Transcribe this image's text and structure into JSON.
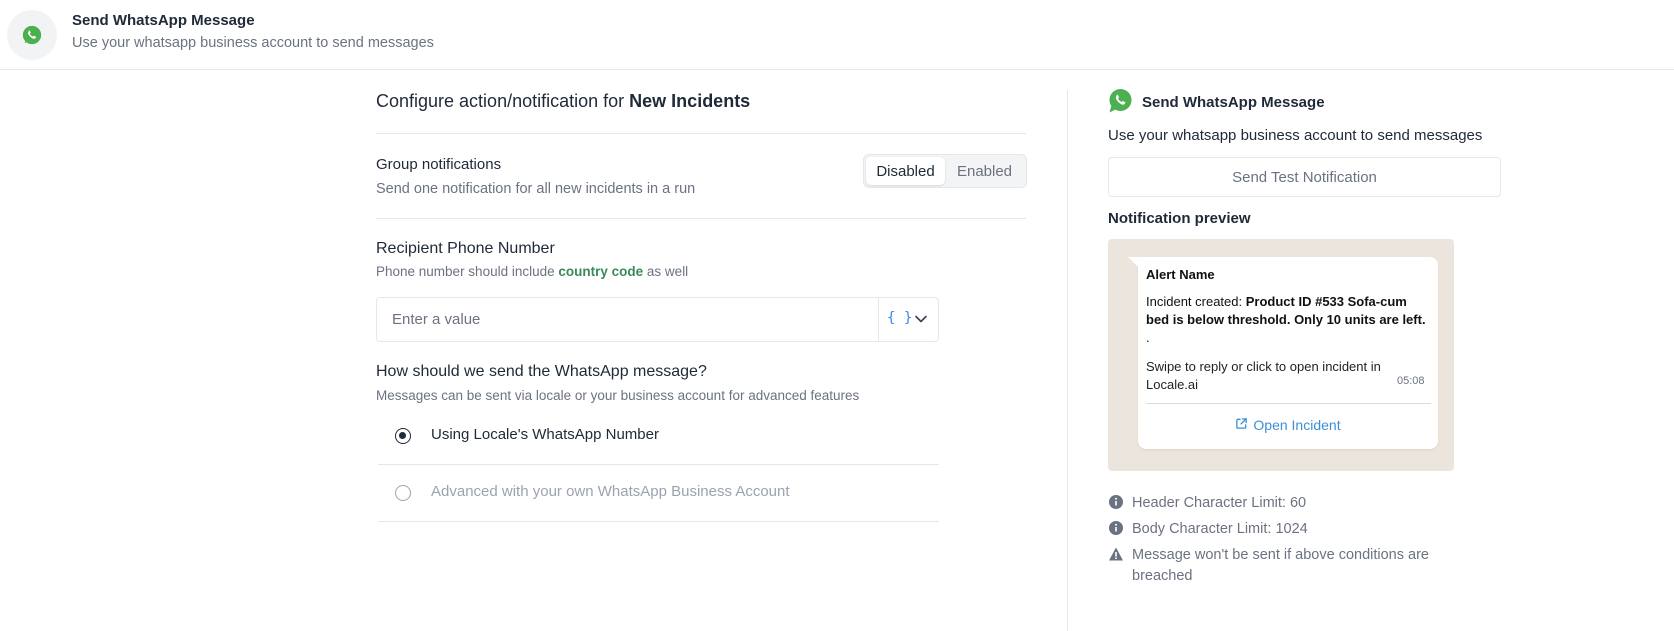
{
  "header": {
    "title": "Send WhatsApp Message",
    "subtitle": "Use your whatsapp business account to send messages"
  },
  "config": {
    "title_prefix": "Configure action/notification for",
    "title_entity": "New Incidents",
    "group": {
      "title": "Group notifications",
      "subtitle": "Send one notification for all new incidents in a run",
      "options": [
        "Disabled",
        "Enabled"
      ],
      "selected": "Disabled"
    },
    "recipient": {
      "title": "Recipient Phone Number",
      "hint_prefix": "Phone number should include",
      "hint_bold": "country code",
      "hint_suffix": "as well",
      "placeholder": "Enter a value",
      "variable_icon": "{ }"
    },
    "method": {
      "title": "How should we send the WhatsApp message?",
      "subtitle": "Messages can be sent via locale or your business account for advanced features",
      "options": [
        {
          "label": "Using Locale's WhatsApp Number",
          "selected": true
        },
        {
          "label": "Advanced with your own WhatsApp Business Account",
          "selected": false
        }
      ]
    }
  },
  "panel": {
    "title": "Send WhatsApp Message",
    "subtitle": "Use your whatsapp business account to send messages",
    "test_button": "Send Test Notification",
    "preview_title": "Notification preview",
    "preview": {
      "alert_name": "Alert Name",
      "body_prefix": "Incident created:",
      "body_bold": "Product ID #533 Sofa-cum bed is below threshold. Only 10 units are left.",
      "body_suffix": ".",
      "footer": "Swipe to reply or click to open incident in Locale.ai",
      "time": "05:08",
      "link": "Open Incident"
    },
    "limits": [
      {
        "icon": "info-icon",
        "text": "Header Character Limit: 60"
      },
      {
        "icon": "info-icon",
        "text": "Body Character Limit: 1024"
      },
      {
        "icon": "warning-icon",
        "text": "Message won't be sent if above conditions are breached"
      }
    ]
  },
  "colors": {
    "whatsapp_green": "#4caf50",
    "link_blue": "#3b8fd6",
    "hint_green": "#3a8a5c",
    "preview_bg": "#ece5dd"
  }
}
